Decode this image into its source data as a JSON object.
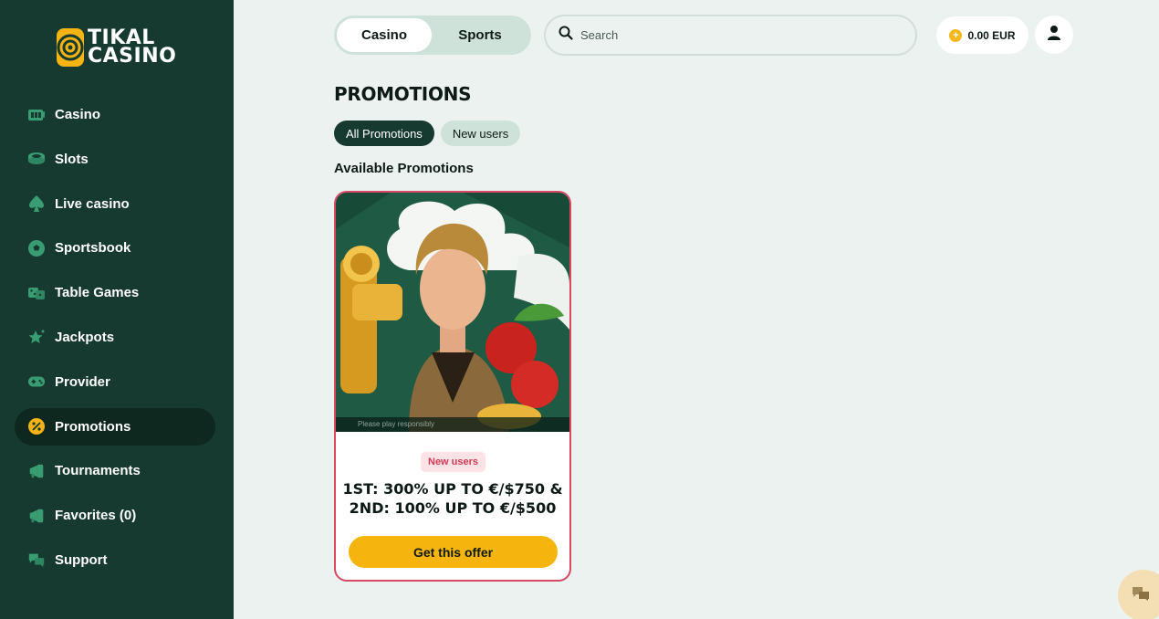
{
  "brand": {
    "line1": "TIKAL",
    "line2": "CASINO"
  },
  "sidebar": {
    "items": [
      {
        "label": "Casino",
        "icon": "casino-icon"
      },
      {
        "label": "Slots",
        "icon": "slots-icon"
      },
      {
        "label": "Live casino",
        "icon": "spade-icon"
      },
      {
        "label": "Sportsbook",
        "icon": "soccer-ball-icon"
      },
      {
        "label": "Table Games",
        "icon": "dice-icon"
      },
      {
        "label": "Jackpots",
        "icon": "star-icon"
      },
      {
        "label": "Provider",
        "icon": "gamepad-icon"
      },
      {
        "label": "Promotions",
        "icon": "percent-icon",
        "active": true
      },
      {
        "label": "Tournaments",
        "icon": "megaphone-icon"
      },
      {
        "label": "Favorites (0)",
        "icon": "favorites-icon"
      },
      {
        "label": "Support",
        "icon": "chat-icon"
      }
    ]
  },
  "header": {
    "tabs": [
      "Casino",
      "Sports"
    ],
    "active_tab": "Casino",
    "search_placeholder": "Search",
    "balance": "0.00 EUR"
  },
  "main": {
    "title": "PROMOTIONS",
    "filters": [
      "All Promotions",
      "New users"
    ],
    "active_filter": "All Promotions",
    "section_title": "Available Promotions",
    "promo": {
      "image_caption": "Please play responsibly",
      "badge": "New users",
      "line1": "1ST: 300% UP TO €/$750 &",
      "line2": "2ND: 100% UP TO €/$500",
      "button": "Get this offer"
    }
  },
  "colors": {
    "sidebar_bg": "#163a2f",
    "page_bg": "#ecf2ef",
    "accent_yellow": "#f6b40e",
    "card_border": "#d84a64",
    "badge_text": "#d63a55"
  }
}
